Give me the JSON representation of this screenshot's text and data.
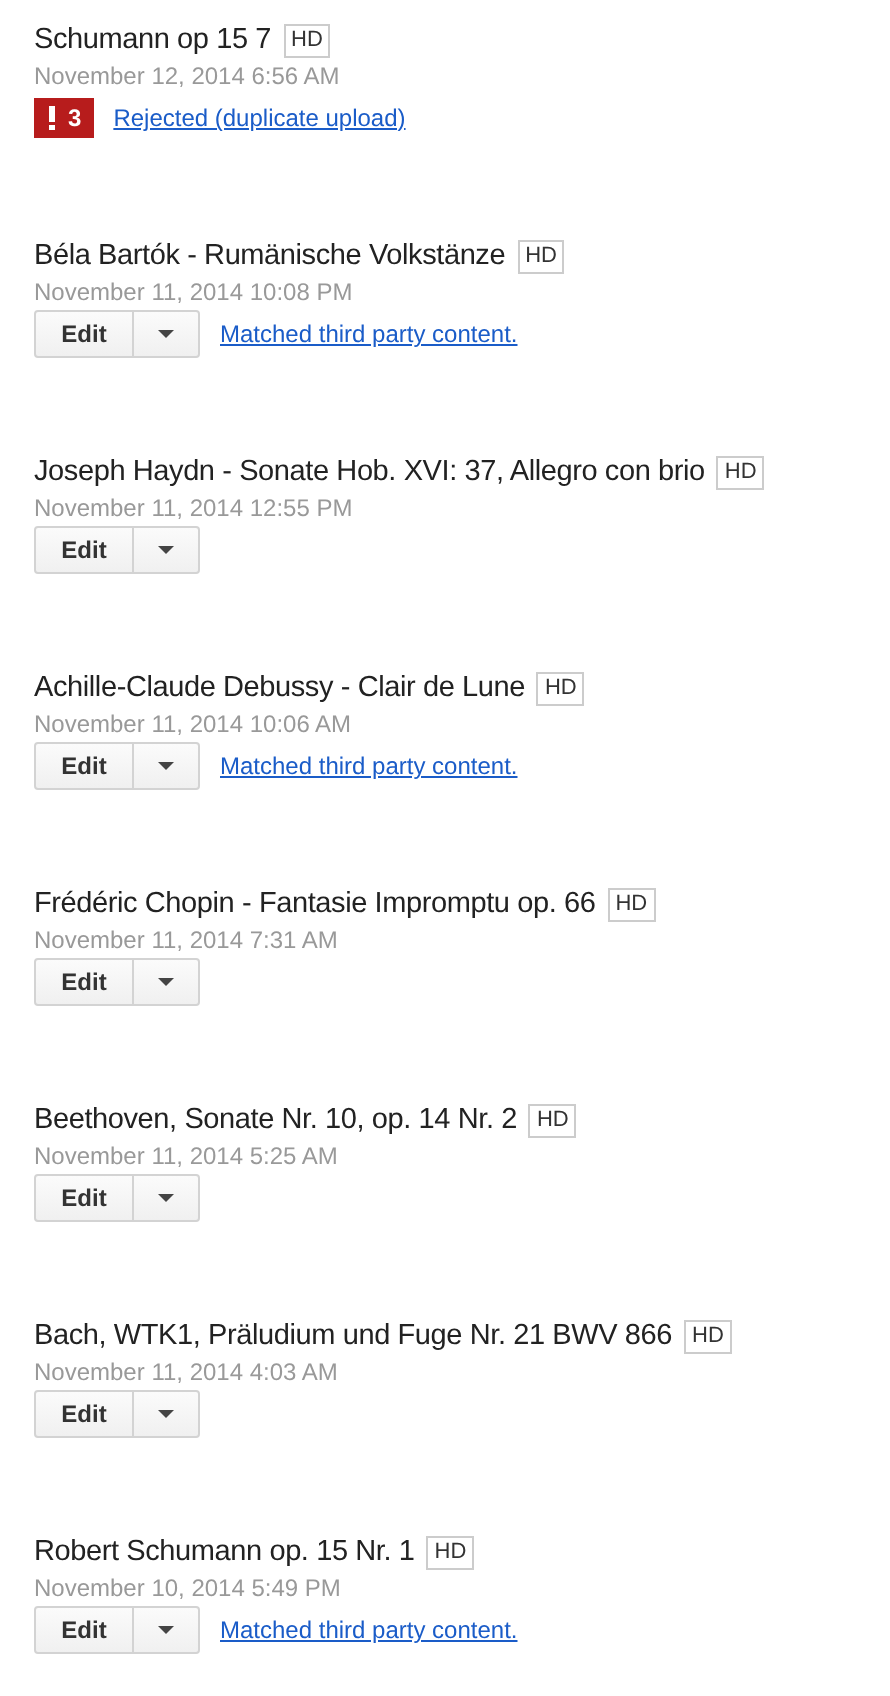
{
  "videos": [
    {
      "title": "Schumann op 15 7",
      "badge": "HD",
      "date": "November 12, 2014 6:56 AM",
      "kind": "rejected",
      "alert_count": "3",
      "status": "Rejected (duplicate upload)"
    },
    {
      "title": "Béla Bartók - Rumänische Volkstänze",
      "badge": "HD",
      "date": "November 11, 2014 10:08 PM",
      "kind": "editable",
      "edit_label": "Edit",
      "status": "Matched third party content."
    },
    {
      "title": "Joseph Haydn - Sonate Hob. XVI: 37, Allegro con brio",
      "badge": "HD",
      "date": "November 11, 2014 12:55 PM",
      "kind": "editable",
      "edit_label": "Edit"
    },
    {
      "title": "Achille-Claude Debussy - Clair de Lune",
      "badge": "HD",
      "date": "November 11, 2014 10:06 AM",
      "kind": "editable",
      "edit_label": "Edit",
      "status": "Matched third party content."
    },
    {
      "title": "Frédéric Chopin - Fantasie Impromptu op. 66",
      "badge": "HD",
      "date": "November 11, 2014 7:31 AM",
      "kind": "editable",
      "edit_label": "Edit"
    },
    {
      "title": "Beethoven, Sonate Nr. 10, op. 14 Nr. 2",
      "badge": "HD",
      "date": "November 11, 2014 5:25 AM",
      "kind": "editable",
      "edit_label": "Edit"
    },
    {
      "title": "Bach, WTK1, Präludium und Fuge Nr. 21 BWV 866",
      "badge": "HD",
      "date": "November 11, 2014 4:03 AM",
      "kind": "editable",
      "edit_label": "Edit"
    },
    {
      "title": "Robert Schumann op. 15 Nr. 1",
      "badge": "HD",
      "date": "November 10, 2014 5:49 PM",
      "kind": "editable",
      "edit_label": "Edit",
      "status": "Matched third party content."
    }
  ]
}
